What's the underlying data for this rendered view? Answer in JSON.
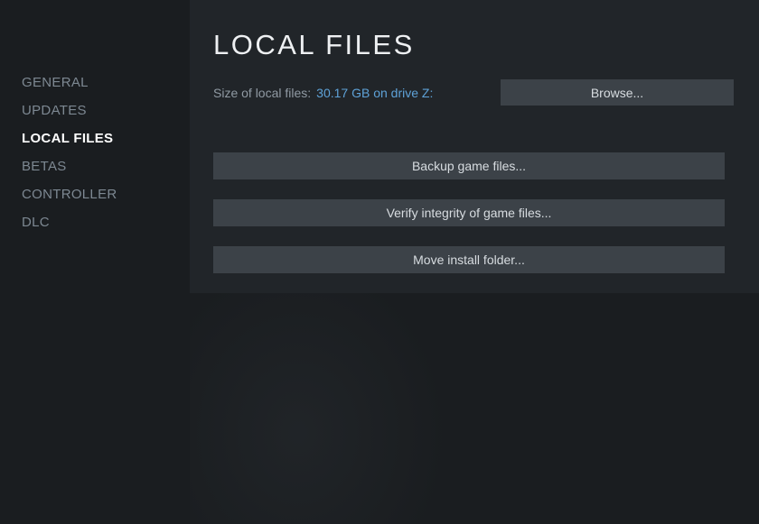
{
  "sidebar": {
    "items": [
      {
        "label": "GENERAL",
        "active": false
      },
      {
        "label": "UPDATES",
        "active": false
      },
      {
        "label": "LOCAL FILES",
        "active": true
      },
      {
        "label": "BETAS",
        "active": false
      },
      {
        "label": "CONTROLLER",
        "active": false
      },
      {
        "label": "DLC",
        "active": false
      }
    ]
  },
  "header": {
    "title": "LOCAL FILES"
  },
  "size_row": {
    "label": "Size of local files:",
    "value": "30.17 GB on drive Z:",
    "browse_label": "Browse..."
  },
  "actions": {
    "backup_label": "Backup game files...",
    "verify_label": "Verify integrity of game files...",
    "move_label": "Move install folder..."
  }
}
